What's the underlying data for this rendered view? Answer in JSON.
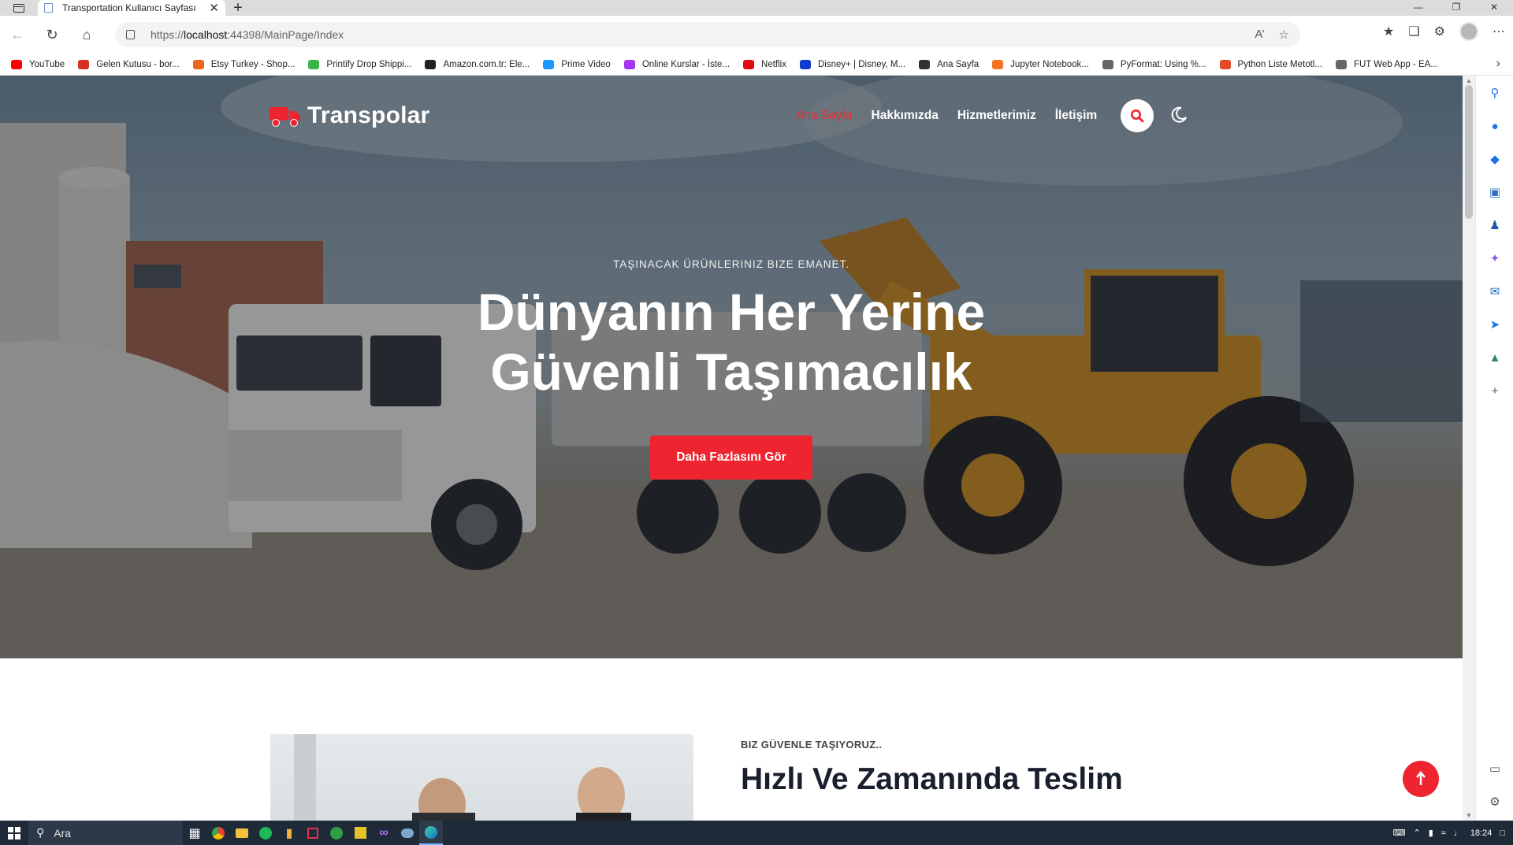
{
  "browser": {
    "tab_title": "Transportation Kullanıcı Sayfası",
    "url_host_prefix": "https://",
    "url_host": "localhost",
    "url_rest": ":44398/MainPage/Index",
    "bookmarks": [
      {
        "label": "YouTube",
        "icon": "youtube-icon",
        "color": "#ff0000"
      },
      {
        "label": "Gelen Kutusu - bor...",
        "icon": "gmail-icon",
        "color": "#d93025"
      },
      {
        "label": "Etsy Turkey - Shop...",
        "icon": "etsy-icon",
        "color": "#f1641e"
      },
      {
        "label": "Printify Drop Shippi...",
        "icon": "printify-icon",
        "color": "#39b54a"
      },
      {
        "label": "Amazon.com.tr: Ele...",
        "icon": "amazon-icon",
        "color": "#222222"
      },
      {
        "label": "Prime Video",
        "icon": "prime-video-icon",
        "color": "#1a98ff"
      },
      {
        "label": "Online Kurslar - İste...",
        "icon": "udemy-icon",
        "color": "#a435f0"
      },
      {
        "label": "Netflix",
        "icon": "netflix-icon",
        "color": "#e50914"
      },
      {
        "label": "Disney+ | Disney, M...",
        "icon": "disney-icon",
        "color": "#113ccf"
      },
      {
        "label": "Ana Sayfa",
        "icon": "profile-icon",
        "color": "#333333"
      },
      {
        "label": "Jupyter Notebook...",
        "icon": "jupyter-icon",
        "color": "#f37626"
      },
      {
        "label": "PyFormat: Using %...",
        "icon": "page-icon",
        "color": "#666666"
      },
      {
        "label": "Python Liste Metotl...",
        "icon": "code-icon",
        "color": "#e34c26"
      },
      {
        "label": "FUT Web App - EA...",
        "icon": "page-icon",
        "color": "#666666"
      }
    ]
  },
  "site": {
    "brand": "Transpolar",
    "menu": [
      "Ana Sayfa",
      "Hakkımızda",
      "Hizmetlerimiz",
      "İletişim"
    ],
    "accent": "#ee2430",
    "hero": {
      "kicker": "TAŞINACAK ÜRÜNLERINIZ BIZE EMANET.",
      "title_line1": "Dünyanın Her Yerine",
      "title_line2": "Güvenli Taşımacılık",
      "cta": "Daha Fazlasını Gör"
    },
    "about": {
      "kicker": "BIZ GÜVENLE TAŞIYORUZ..",
      "title": "Hızlı Ve Zamanında Teslim"
    }
  },
  "taskbar": {
    "search_placeholder": "Ara",
    "time": "18:24"
  }
}
